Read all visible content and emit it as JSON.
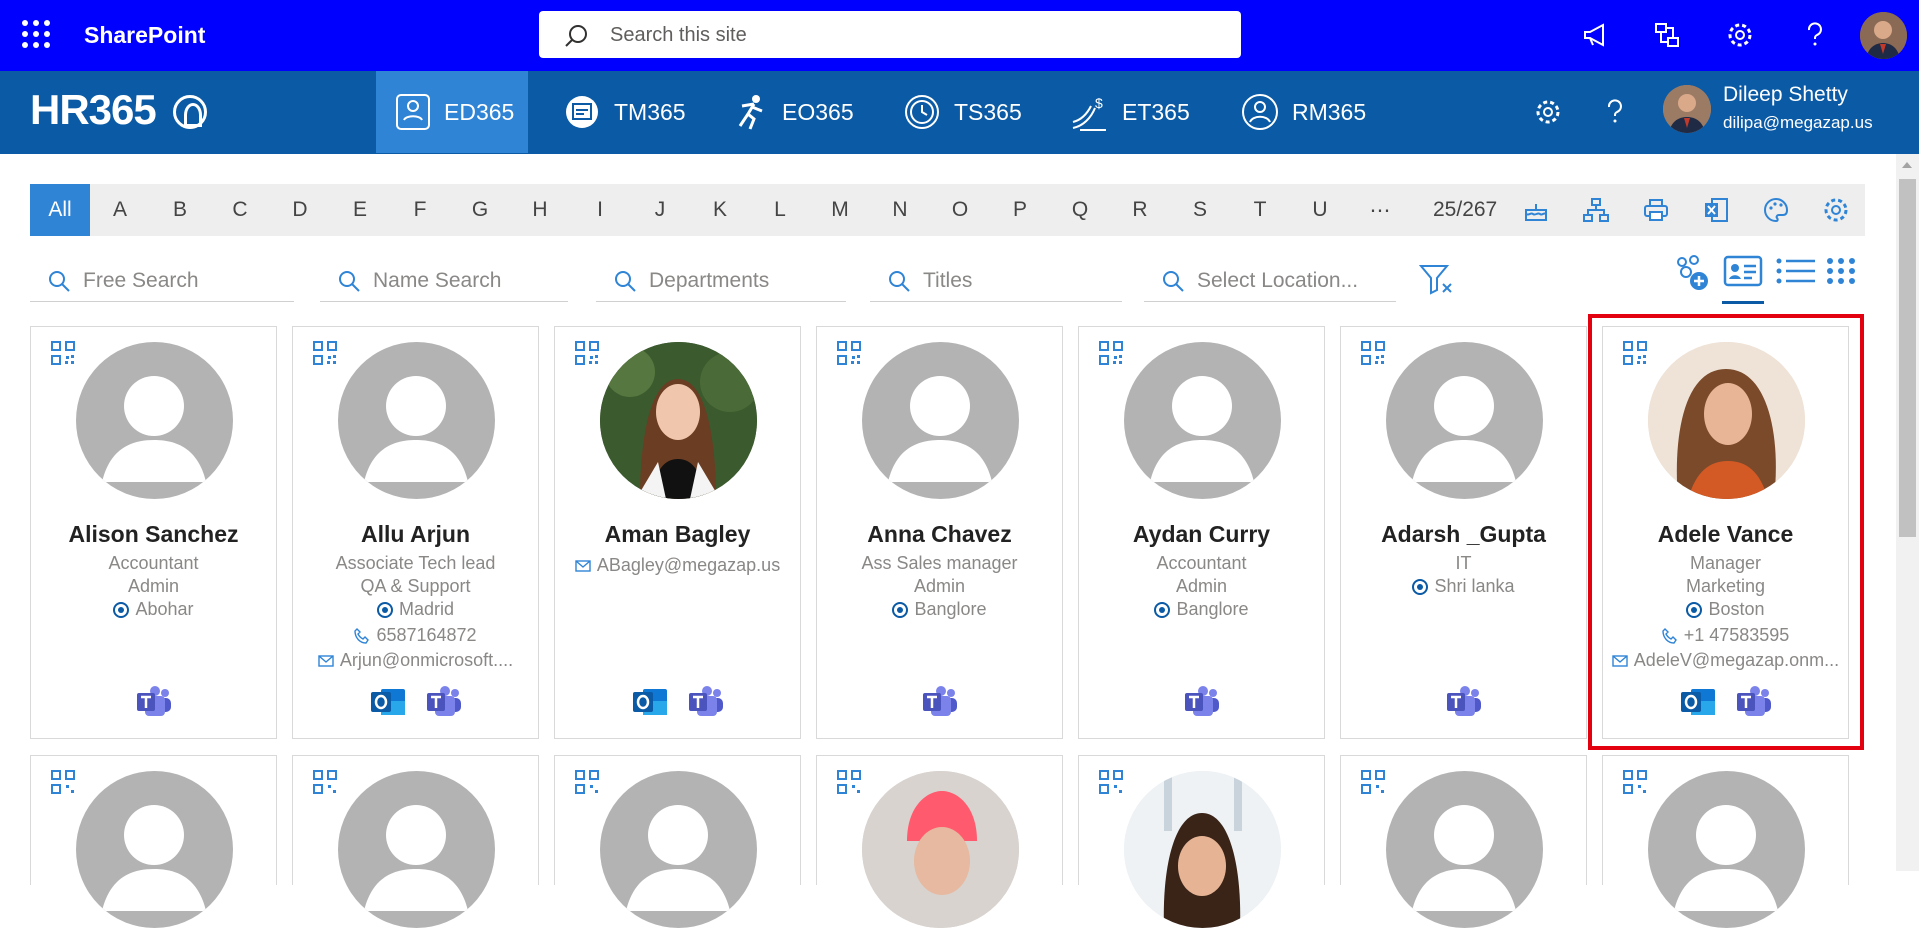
{
  "suite": {
    "title": "SharePoint",
    "search_placeholder": "Search this site"
  },
  "app": {
    "logo": "HR365",
    "tabs": [
      {
        "label": "ED365",
        "active": true
      },
      {
        "label": "TM365"
      },
      {
        "label": "EO365"
      },
      {
        "label": "TS365"
      },
      {
        "label": "ET365"
      },
      {
        "label": "RM365"
      }
    ],
    "user": {
      "name": "Dileep Shetty",
      "email": "dilipa@megazap.us"
    }
  },
  "alphabet": {
    "letters": [
      "All",
      "A",
      "B",
      "C",
      "D",
      "E",
      "F",
      "G",
      "H",
      "I",
      "J",
      "K",
      "L",
      "M",
      "N",
      "O",
      "P",
      "Q",
      "R",
      "S",
      "T",
      "U",
      "⋯"
    ],
    "selected": "All",
    "count": "25/267"
  },
  "filters": {
    "free": "Free Search",
    "name": "Name Search",
    "departments": "Departments",
    "titles": "Titles",
    "location": "Select Location..."
  },
  "cards": [
    {
      "name": "Alison Sanchez",
      "title": "Accountant",
      "dept": "Admin",
      "location": "Abohar",
      "apps": [
        "teams"
      ]
    },
    {
      "name": "Allu Arjun",
      "title": "Associate Tech lead",
      "dept": "QA & Support",
      "location": "Madrid",
      "phone": "6587164872",
      "email": "Arjun@onmicrosoft....",
      "apps": [
        "outlook",
        "teams"
      ]
    },
    {
      "name": "Aman Bagley",
      "email": "ABagley@megazap.us",
      "apps": [
        "outlook",
        "teams"
      ]
    },
    {
      "name": "Anna Chavez",
      "title": "Ass Sales manager",
      "dept": "Admin",
      "location": "Banglore",
      "apps": [
        "teams"
      ]
    },
    {
      "name": "Aydan Curry",
      "title": "Accountant",
      "dept": "Admin",
      "location": "Banglore",
      "apps": [
        "teams"
      ]
    },
    {
      "name": "Adarsh _Gupta",
      "title": "IT",
      "location": "Shri lanka",
      "apps": [
        "teams"
      ]
    },
    {
      "name": "Adele Vance",
      "title": "Manager",
      "dept": "Marketing",
      "location": "Boston",
      "phone": "+1 47583595",
      "email": "AdeleV@megazap.onm...",
      "apps": [
        "outlook",
        "teams"
      ]
    }
  ],
  "colors": {
    "suitebar": "#0000ff",
    "appbar": "#0a5aa5",
    "accent": "#2f84d6",
    "highlight": "#e3000f"
  }
}
